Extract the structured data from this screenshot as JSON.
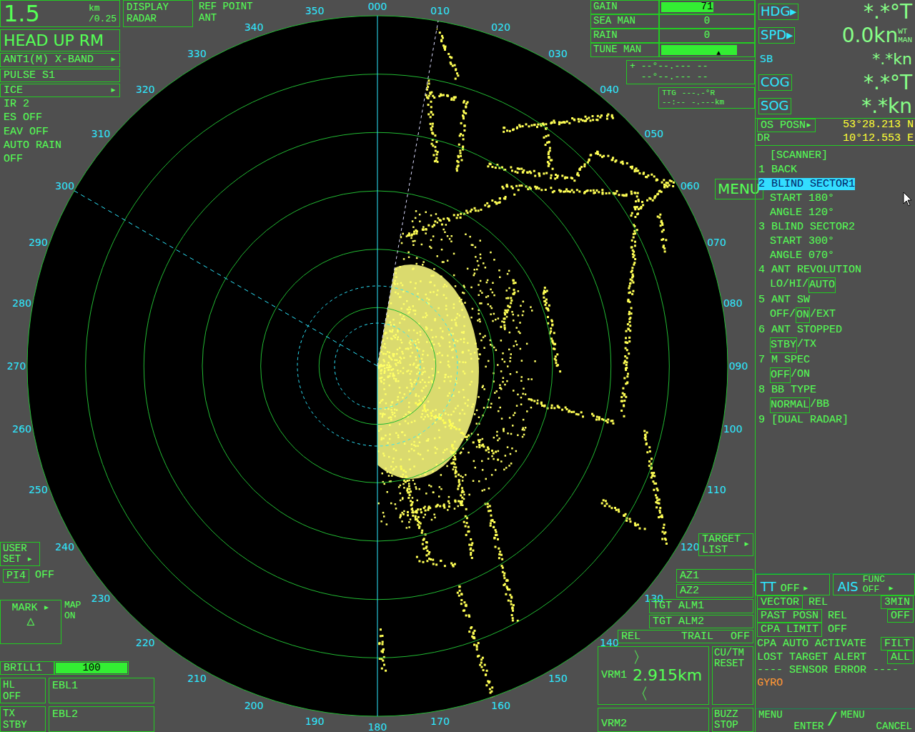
{
  "range": {
    "value": "1.5",
    "unit": "km",
    "interval": "/0.25"
  },
  "display": {
    "label": "DISPLAY",
    "value": "RADAR"
  },
  "ref_point": {
    "label": "REF POINT",
    "value": "ANT"
  },
  "mode": "HEAD UP RM",
  "settings": [
    {
      "text": "ANT1(M) X-BAND",
      "arrow": "▸",
      "kind": "boxed"
    },
    {
      "text": "PULSE S1",
      "kind": "boxed"
    },
    {
      "text": "ICE",
      "arrow": "▸",
      "kind": "boxed"
    },
    {
      "text": "IR  2",
      "kind": "plain"
    },
    {
      "text": "ES  OFF",
      "kind": "plain"
    },
    {
      "text": "EAV OFF",
      "kind": "plain"
    },
    {
      "text": "AUTO RAIN",
      "kind": "plain"
    },
    {
      "text": "OFF",
      "kind": "plain"
    }
  ],
  "bearings": [
    "000",
    "010",
    "020",
    "030",
    "040",
    "050",
    "060",
    "070",
    "080",
    "090",
    "100",
    "110",
    "120",
    "130",
    "140",
    "150",
    "160",
    "170",
    "180",
    "190",
    "200",
    "210",
    "220",
    "230",
    "240",
    "250",
    "260",
    "270",
    "280",
    "290",
    "300",
    "310",
    "320",
    "330",
    "340",
    "350"
  ],
  "controls": [
    {
      "label": "GAIN",
      "level": 0.58,
      "reading": "71"
    },
    {
      "label": "SEA  MAN",
      "level": 0,
      "reading": "0"
    },
    {
      "label": "RAIN",
      "level": 0,
      "reading": "0"
    },
    {
      "label": "TUNE MAN",
      "level": 0.83,
      "marker": "▲"
    }
  ],
  "cursor": {
    "symbol": "+",
    "line1": "--°--.--- --",
    "line2": "--°--.--- --"
  },
  "ttg": {
    "label": "TTG",
    "bearing": "---.-°R",
    "time": "--:--",
    "distance": "-.---km"
  },
  "nav": [
    {
      "label": "HDG",
      "arrow": "▸",
      "value": "*.*°T",
      "kind": "big"
    },
    {
      "label": "SPD",
      "arrow": "▸",
      "value": "0.0kn",
      "sub1": "WT",
      "sub2": "MAN",
      "kind": "big"
    },
    {
      "label": "SB",
      "value": "*.*kn",
      "kind": "small"
    },
    {
      "label": "COG",
      "value": "*.*°T",
      "kind": "big"
    },
    {
      "label": "SOG",
      "value": "*.*kn",
      "kind": "big"
    }
  ],
  "position": {
    "label": "OS POSN",
    "arrow": "▸",
    "source": "DR",
    "lat": "53°28.213 N",
    "lon": "10°12.553 E"
  },
  "menu": {
    "button": "MENU",
    "title": "[SCANNER]",
    "separator": "/",
    "items": [
      {
        "text": "1 BACK",
        "selected": false
      },
      {
        "text": "2 BLIND SECTOR1",
        "selected": true,
        "sub": [
          "START 180°",
          "ANGLE 120°"
        ]
      },
      {
        "text": "3 BLIND SECTOR2",
        "selected": false,
        "sub": [
          "START 300°",
          "ANGLE 070°"
        ]
      },
      {
        "text": "4 ANT REVOLUTION",
        "selected": false,
        "options": [
          {
            "text": "LO",
            "selected": false
          },
          {
            "text": "HI",
            "selected": false
          },
          {
            "text": "AUTO",
            "selected": true
          }
        ]
      },
      {
        "text": "5 ANT SW",
        "selected": false,
        "options": [
          {
            "text": "OFF",
            "selected": false
          },
          {
            "text": "ON",
            "selected": true
          },
          {
            "text": "EXT",
            "selected": false
          }
        ]
      },
      {
        "text": "6 ANT STOPPED",
        "selected": false,
        "options": [
          {
            "text": "STBY",
            "selected": true
          },
          {
            "text": "TX",
            "selected": false
          }
        ]
      },
      {
        "text": "7 M SPEC",
        "selected": false,
        "options": [
          {
            "text": "OFF",
            "selected": true
          },
          {
            "text": "ON",
            "selected": false
          }
        ]
      },
      {
        "text": "8 BB TYPE",
        "selected": false,
        "options": [
          {
            "text": "NORMAL",
            "selected": true
          },
          {
            "text": "BB",
            "selected": false
          }
        ]
      },
      {
        "text": "9 [DUAL RADAR]",
        "selected": false
      }
    ]
  },
  "target_list": {
    "line1": "TARGET",
    "line2": "LIST",
    "arrow": "▸"
  },
  "tt": {
    "label": "TT",
    "value": "OFF",
    "arrow": "▸"
  },
  "ais": {
    "label": "AIS",
    "func": "FUNC",
    "value": "OFF",
    "arrow": "▸"
  },
  "vector_rows": [
    {
      "label": "VECTOR",
      "value": "REL",
      "extra": "3MIN",
      "kind": "boxed"
    },
    {
      "label": "PAST POSN",
      "value": "REL",
      "extra": "OFF",
      "kind": "boxed"
    },
    {
      "label": "CPA LIMIT",
      "value": "OFF",
      "kind": "boxed"
    },
    {
      "label": "CPA AUTO ACTIVATE",
      "extra": "FILT",
      "kind": "plain"
    },
    {
      "label": "LOST TARGET ALERT",
      "extra": "ALL",
      "kind": "plain"
    }
  ],
  "sensor_error": {
    "title": "---- SENSOR ERROR ----",
    "items": [
      "GYRO"
    ]
  },
  "alarms": [
    "AZ1",
    "AZ2",
    "TGT ALM1",
    "TGT ALM2"
  ],
  "trail": {
    "label": "REL",
    "mode": "TRAIL",
    "value": "OFF"
  },
  "vrm": [
    {
      "label": "VRM1",
      "value": "〉2.915km〈"
    },
    {
      "label": "VRM2"
    }
  ],
  "cu_tm": {
    "line1": "CU/TM",
    "line2": "RESET"
  },
  "buzz": {
    "line1": "BUZZ",
    "line2": "STOP"
  },
  "menu_keys": {
    "left": "MENU",
    "left2": "ENTER",
    "sep": "/",
    "right": "MENU",
    "right2": "CANCEL"
  },
  "user_set": {
    "line1": "USER",
    "line2": "SET",
    "arrow": "▸"
  },
  "pi": {
    "label": "PI4",
    "value": "OFF"
  },
  "mark": {
    "label": "MARK",
    "arrow": "▸",
    "symbol": "△"
  },
  "map": {
    "label": "MAP",
    "value": "ON"
  },
  "brill": {
    "label": "BRILL1",
    "reading": "100",
    "level": 1
  },
  "hl": {
    "label": "HL",
    "value": "OFF"
  },
  "tx": {
    "label": "TX",
    "value": "STBY"
  },
  "ebl": [
    "EBL1",
    "EBL2"
  ]
}
